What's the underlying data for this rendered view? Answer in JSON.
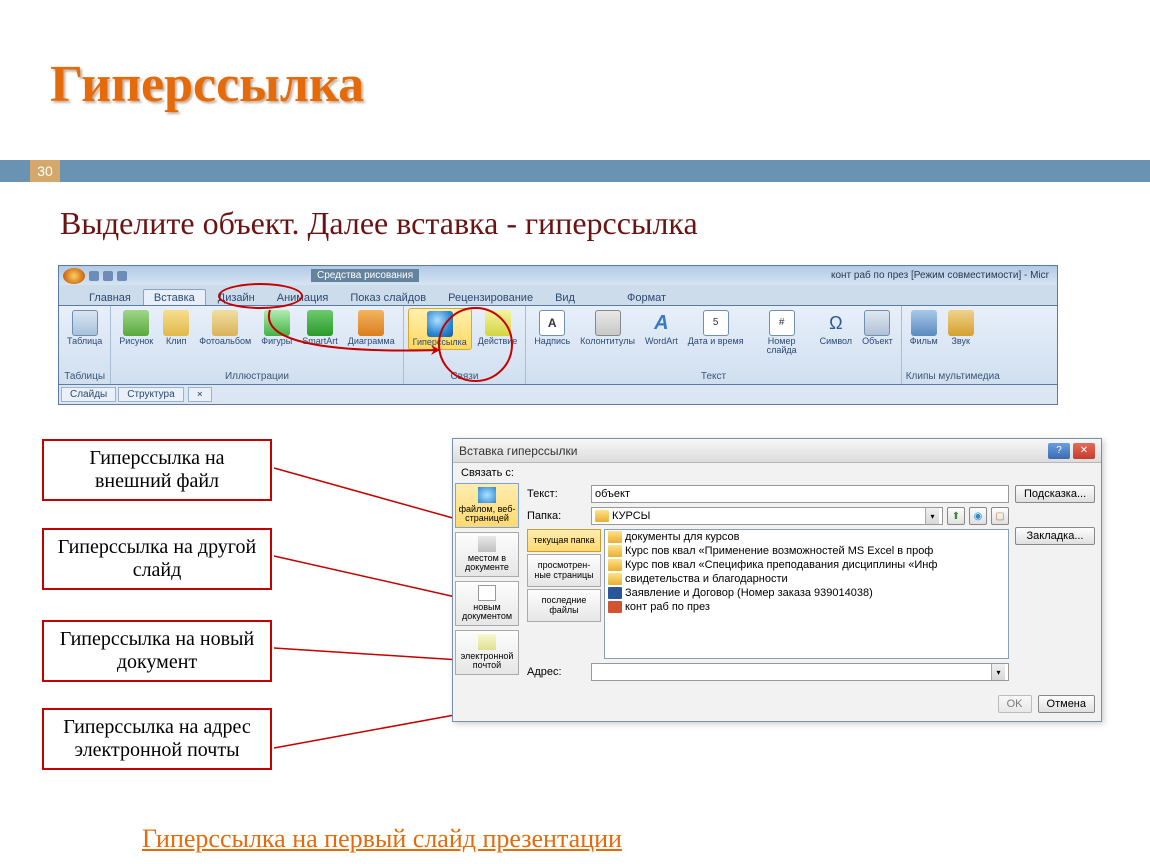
{
  "slide": {
    "title": "Гиперссылка",
    "page_num": "30",
    "instruction": "Выделите объект. Далее вставка - гиперссылка",
    "bottom_link": "Гиперссылка на первый слайд презентации"
  },
  "ribbon": {
    "contextual_tab": "Средства рисования",
    "window_title": "конт раб по през [Режим совместимости] - Micr",
    "tabs": [
      "Главная",
      "Вставка",
      "Дизайн",
      "Анимация",
      "Показ слайдов",
      "Рецензирование",
      "Вид",
      "Формат"
    ],
    "active_tab": "Вставка",
    "groups": {
      "tables": {
        "label": "Таблицы",
        "btn_table": "Таблица"
      },
      "illustr": {
        "label": "Иллюстрации",
        "btn_picture": "Рисунок",
        "btn_clip": "Клип",
        "btn_album": "Фотоальбом",
        "btn_shapes": "Фигуры",
        "btn_smartart": "SmartArt",
        "btn_chart": "Диаграмма"
      },
      "links": {
        "label": "Связи",
        "btn_hyperlink": "Гиперссылка",
        "btn_action": "Действие"
      },
      "text": {
        "label": "Текст",
        "btn_textbox": "Надпись",
        "btn_header": "Колонтитулы",
        "btn_wordart": "WordArt",
        "btn_datetime": "Дата и время",
        "btn_slidenum": "Номер слайда",
        "btn_symbol": "Символ",
        "btn_object": "Объект"
      },
      "media": {
        "label": "Клипы мультимедиа",
        "btn_movie": "Фильм",
        "btn_sound": "Звук"
      }
    },
    "pane_tabs": {
      "slides": "Слайды",
      "outline": "Структура"
    }
  },
  "callouts": {
    "ext_file": "Гиперссылка на внешний файл",
    "other_slide": "Гиперссылка на другой слайд",
    "new_doc": "Гиперссылка на новый документ",
    "email": "Гиперссылка на адрес электронной почты"
  },
  "dialog": {
    "title": "Вставка гиперссылки",
    "link_with_label": "Связать с:",
    "text_label": "Текст:",
    "text_value": "объект",
    "tip_button": "Подсказка...",
    "folder_label": "Папка:",
    "folder_value": "КУРСЫ",
    "bookmark_button": "Закладка...",
    "address_label": "Адрес:",
    "address_value": "",
    "ok": "OK",
    "cancel": "Отмена",
    "link_types": {
      "file_web": "файлом, веб-страницей",
      "place_doc": "местом в документе",
      "new_doc": "новым документом",
      "email": "электронной почтой"
    },
    "browse_tabs": {
      "current_folder": "текущая папка",
      "viewed_pages": "просмотрен-ные страницы",
      "recent_files": "последние файлы"
    },
    "files": [
      {
        "type": "folder",
        "name": "документы для курсов"
      },
      {
        "type": "folder",
        "name": "Курс пов квал «Применение возможностей MS Excel в проф"
      },
      {
        "type": "folder",
        "name": "Курс пов квал «Специфика преподавания дисциплины «Инф"
      },
      {
        "type": "folder",
        "name": "свидетельства и благодарности"
      },
      {
        "type": "word",
        "name": "Заявление и Договор (Номер заказа 939014038)"
      },
      {
        "type": "ppt",
        "name": "конт раб по през"
      }
    ]
  }
}
